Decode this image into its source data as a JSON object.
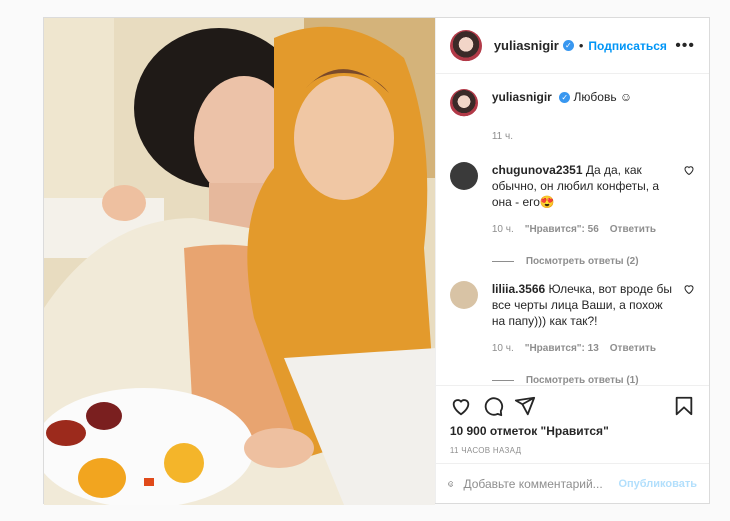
{
  "post": {
    "author": "yuliasnigir",
    "dot": "•",
    "follow_label": "Подписаться",
    "more_icon": "•••",
    "verified_mark": "✓",
    "caption": {
      "user": "yuliasnigir",
      "text": "Любовь ☺",
      "time": "11 ч."
    },
    "comments": [
      {
        "user": "chugunova2351",
        "text": "Да да, как обычно, он любил конфеты, а она - его😍",
        "time": "10 ч.",
        "likes": "\"Нравится\": 56",
        "reply_label": "Ответить",
        "view_replies": "Посмотреть ответы (2)",
        "avatar_color": "#3a3a3a"
      },
      {
        "user": "liliia.3566",
        "text": "Юлечка, вот вроде бы все черты лица Ваши, а похож на папу))) как так?!",
        "time": "10 ч.",
        "likes": "\"Нравится\": 13",
        "reply_label": "Ответить",
        "view_replies": "Посмотреть ответы (1)",
        "avatar_color": "#d8c3a5"
      }
    ],
    "like_count": "10 900 отметок \"Нравится\"",
    "timestamp": "11 ЧАСОВ НАЗАД",
    "add_comment": {
      "placeholder": "Добавьте комментарий...",
      "publish_label": "Опубликовать"
    }
  }
}
